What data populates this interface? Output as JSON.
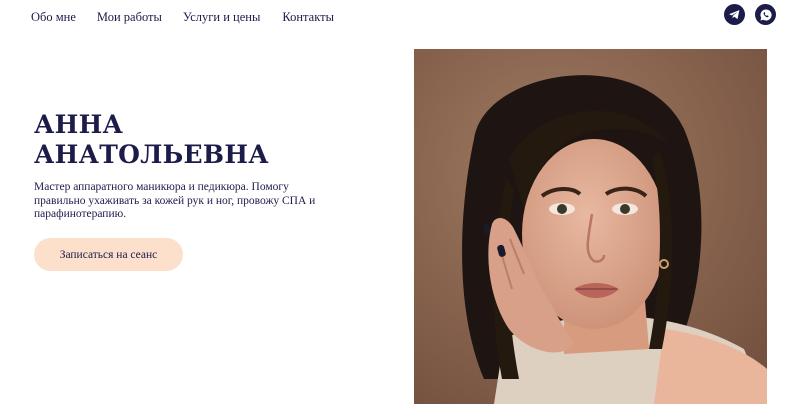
{
  "nav": {
    "items": [
      {
        "label": "Обо мне"
      },
      {
        "label": "Мои работы"
      },
      {
        "label": "Услуги и цены"
      },
      {
        "label": "Контакты"
      }
    ]
  },
  "social": {
    "icons": [
      "telegram-icon",
      "whatsapp-icon"
    ]
  },
  "hero": {
    "title_line1": "АННА",
    "title_line2": "АНАТОЛЬЕВНА",
    "description": "Мастер аппаратного маникюра и педикюра. Помогу правильно ухаживать за кожей рук и ног, провожу СПА и парафинотерапию.",
    "cta_label": "Записаться на сеанс"
  },
  "colors": {
    "primary": "#1c1c4a",
    "cta_background": "#fde0cc",
    "photo_background": "#8a6450"
  }
}
